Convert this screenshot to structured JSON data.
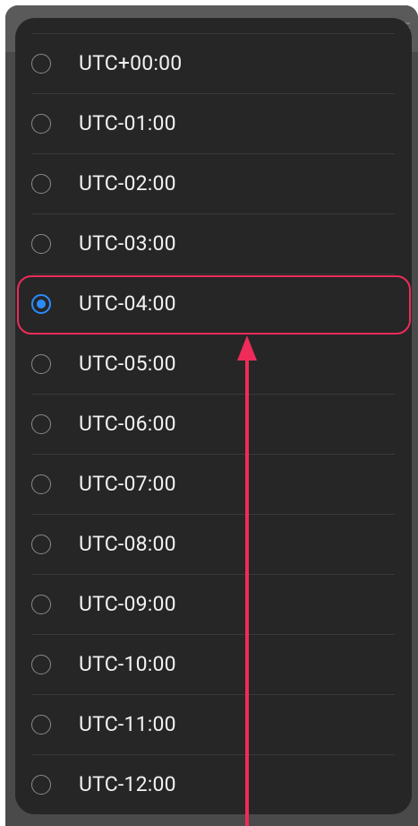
{
  "timezone_list": {
    "selected_index": 4,
    "items": [
      {
        "label": "UTC+00:00"
      },
      {
        "label": "UTC-01:00"
      },
      {
        "label": "UTC-02:00"
      },
      {
        "label": "UTC-03:00"
      },
      {
        "label": "UTC-04:00"
      },
      {
        "label": "UTC-05:00"
      },
      {
        "label": "UTC-06:00"
      },
      {
        "label": "UTC-07:00"
      },
      {
        "label": "UTC-08:00"
      },
      {
        "label": "UTC-09:00"
      },
      {
        "label": "UTC-10:00"
      },
      {
        "label": "UTC-11:00"
      },
      {
        "label": "UTC-12:00"
      }
    ]
  },
  "colors": {
    "accent": "#2a8cff",
    "annotation": "#ef2b5a",
    "sheet_background": "#262626",
    "text": "#f2f2f2"
  },
  "icons": {
    "back": "back-arrow-icon",
    "menu": "menu-icon",
    "radio_unselected": "radio-unchecked-icon",
    "radio_selected": "radio-checked-icon",
    "annotation_arrow": "arrow-up-icon"
  }
}
